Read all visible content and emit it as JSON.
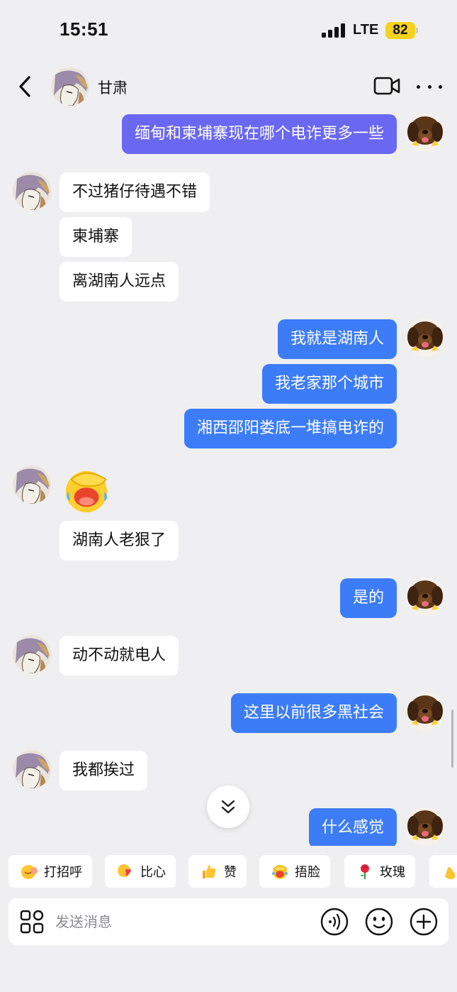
{
  "status_bar": {
    "time": "15:51",
    "network": "LTE",
    "battery": "82"
  },
  "header": {
    "contact_name": "甘肃"
  },
  "messages": [
    {
      "side": "out",
      "text": "缅甸和柬埔寨现在哪个电诈更多一些"
    },
    {
      "side": "in",
      "text": "不过猪仔待遇不错"
    },
    {
      "side": "in",
      "text": "柬埔寨"
    },
    {
      "side": "in",
      "text": "离湖南人远点"
    },
    {
      "side": "out",
      "text": "我就是湖南人"
    },
    {
      "side": "out",
      "text": "我老家那个城市"
    },
    {
      "side": "out",
      "text": "湘西邵阳娄底一堆搞电诈的"
    },
    {
      "side": "in",
      "emoji": "facepalm-laughing-emoji"
    },
    {
      "side": "in",
      "text": "湖南人老狠了"
    },
    {
      "side": "out",
      "text": "是的"
    },
    {
      "side": "in",
      "text": "动不动就电人"
    },
    {
      "side": "out",
      "text": "这里以前很多黑社会"
    },
    {
      "side": "in",
      "text": "我都挨过"
    },
    {
      "side": "out",
      "text": "什么感觉"
    }
  ],
  "quick_replies": [
    {
      "label": "打招呼",
      "icon": "wave-emoji"
    },
    {
      "label": "比心",
      "icon": "heart-hands-emoji"
    },
    {
      "label": "赞",
      "icon": "thumbs-up-emoji"
    },
    {
      "label": "捂脸",
      "icon": "facepalm-emoji"
    },
    {
      "label": "玫瑰",
      "icon": "rose-emoji"
    },
    {
      "label": "",
      "icon": "clap-emoji"
    }
  ],
  "input": {
    "placeholder": "发送消息"
  },
  "colors": {
    "outgoing_bubble": "#3d7cf7",
    "outgoing_bubble_first": "#6a67f2",
    "incoming_bubble": "#ffffff",
    "background": "#efeff1",
    "battery": "#f4d21e"
  }
}
